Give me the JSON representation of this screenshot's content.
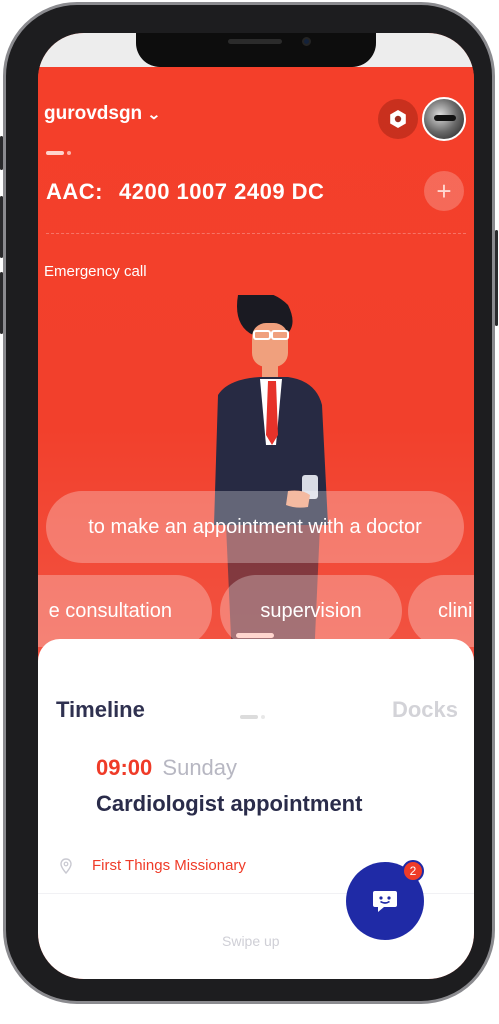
{
  "header": {
    "username": "gurovdsgn",
    "settings_icon": "gear-icon",
    "avatar_icon": "avatar"
  },
  "account": {
    "label": "AAC:",
    "number": "4200 1007 2409 DC",
    "add_icon": "plus-icon"
  },
  "emergency_label": "Emergency call",
  "quick_actions": {
    "primary": "to make an appointment with a doctor",
    "chips": [
      "e consultation",
      "supervision",
      "clini"
    ]
  },
  "sheet": {
    "tabs": [
      "Timeline",
      "Docks"
    ],
    "active_tab": "Timeline",
    "appointment": {
      "time": "09:00",
      "day": "Sunday",
      "title": "Cardiologist appointment",
      "location": "First Things Missionary"
    },
    "swipe_hint": "Swipe up"
  },
  "chat": {
    "badge_count": "2",
    "icon": "chat-icon"
  },
  "colors": {
    "primary_red": "#f23f2b",
    "accent_blue": "#1f2aa6",
    "text_dark": "#2f3150"
  }
}
